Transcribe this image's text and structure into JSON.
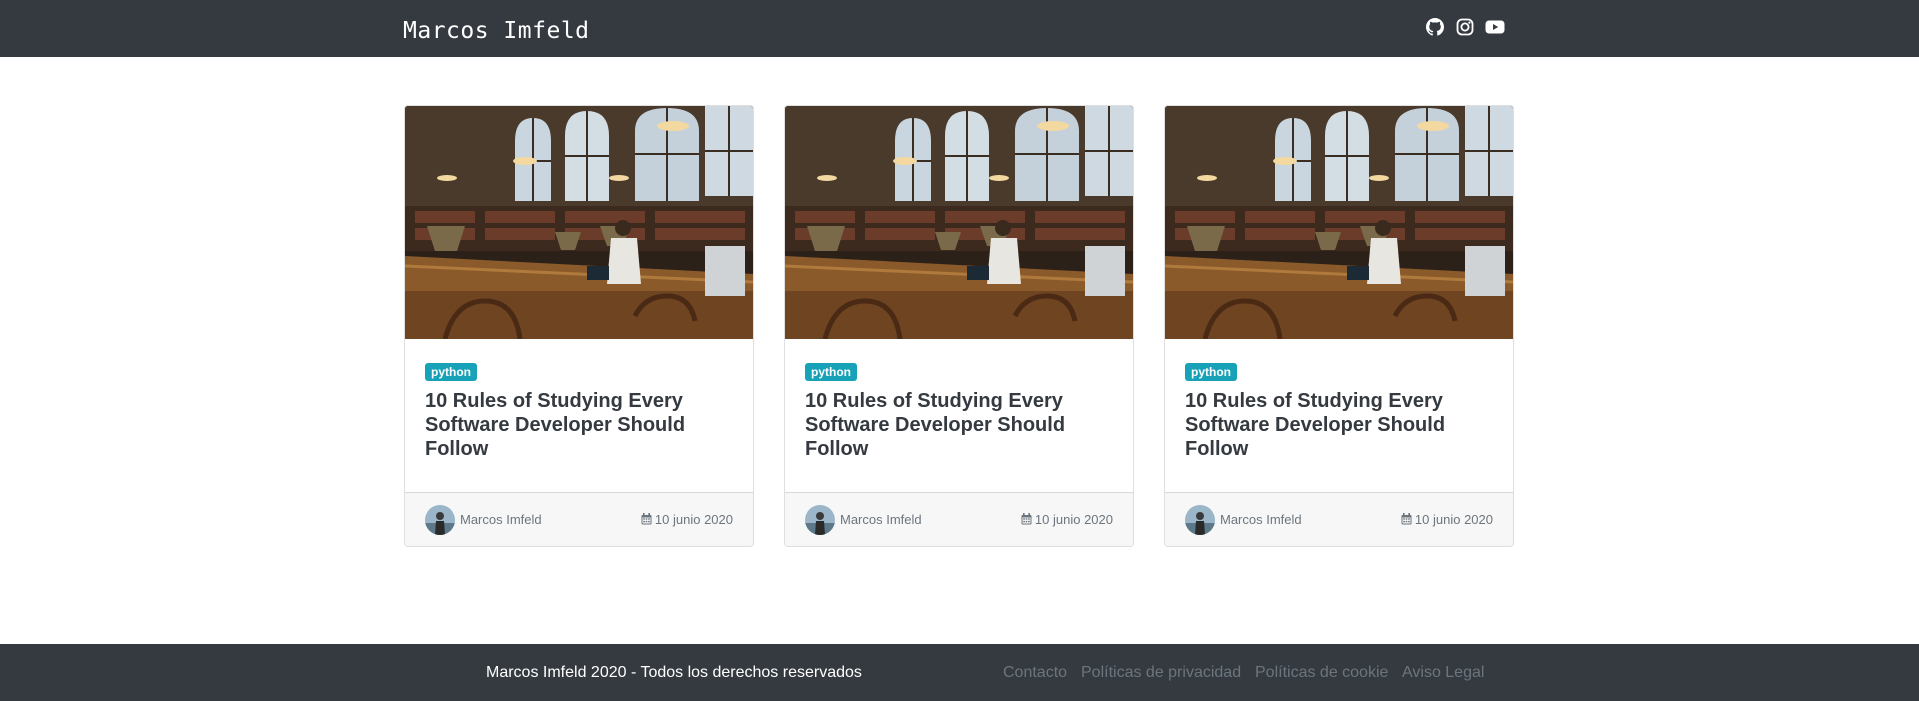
{
  "header": {
    "brand": "Marcos Imfeld",
    "social_icons": [
      "github-icon",
      "instagram-icon",
      "youtube-icon"
    ]
  },
  "posts": [
    {
      "tag": "python",
      "title": "10 Rules of Studying Every Software Developer Should Follow",
      "author": "Marcos Imfeld",
      "date": "10 junio 2020",
      "image": "library-reading-room-photo"
    },
    {
      "tag": "python",
      "title": "10 Rules of Studying Every Software Developer Should Follow",
      "author": "Marcos Imfeld",
      "date": "10 junio 2020",
      "image": "library-reading-room-photo"
    },
    {
      "tag": "python",
      "title": "10 Rules of Studying Every Software Developer Should Follow",
      "author": "Marcos Imfeld",
      "date": "10 junio 2020",
      "image": "library-reading-room-photo"
    }
  ],
  "footer": {
    "copyright": "Marcos Imfeld 2020 - Todos los derechos reservados",
    "links": [
      "Contacto",
      "Políticas de privacidad",
      "Políticas de cookie",
      "Aviso Legal"
    ]
  },
  "colors": {
    "navbar_bg": "#343a40",
    "badge_bg": "#17a2b8",
    "title_text": "#343a40",
    "muted_text": "#6c757d",
    "card_footer_bg": "#f7f7f7"
  }
}
